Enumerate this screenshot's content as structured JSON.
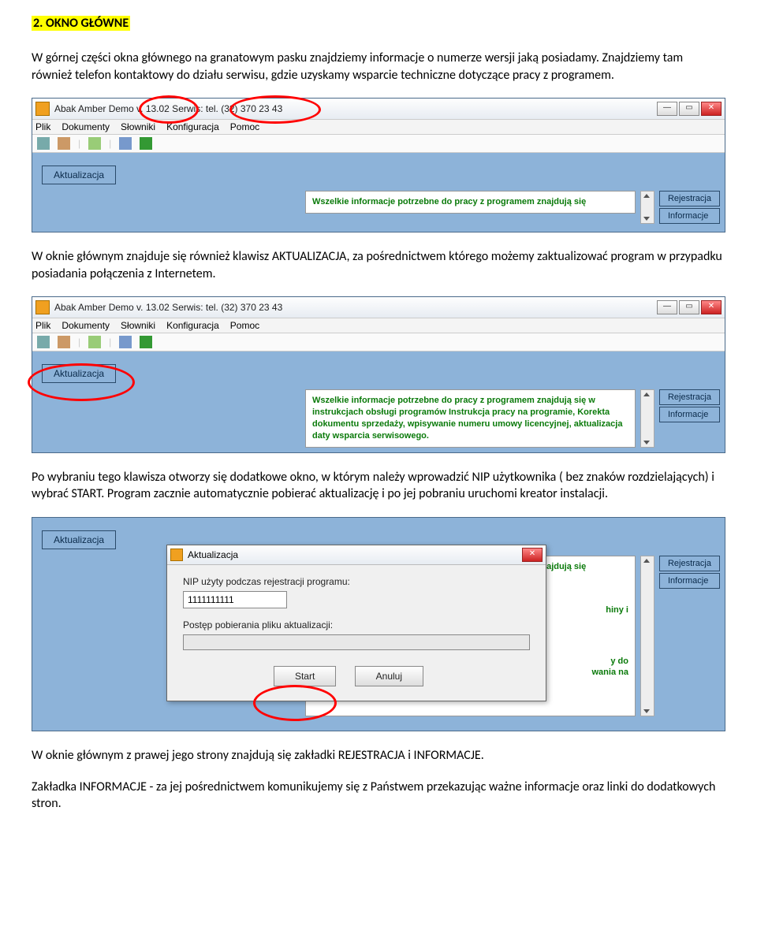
{
  "section": {
    "title": "2. OKNO GŁÓWNE",
    "p1": "W górnej części okna głównego na granatowym pasku znajdziemy informacje o numerze wersji jaką posiadamy. Znajdziemy tam również telefon kontaktowy do działu serwisu, gdzie uzyskamy wsparcie techniczne dotyczące pracy z programem.",
    "p2": "W oknie głównym znajduje się również klawisz AKTUALIZACJA, za pośrednictwem którego możemy zaktualizować program w przypadku posiadania połączenia z Internetem.",
    "p3": "Po wybraniu tego klawisza otworzy się dodatkowe okno, w którym należy wprowadzić NIP użytkownika ( bez znaków rozdzielających) i wybrać START. Program zacznie automatycznie pobierać aktualizację i po jej pobraniu uruchomi kreator instalacji.",
    "p4": "W oknie głównym z prawej jego strony znajdują się zakładki REJESTRACJA i INFORMACJE.",
    "p5": "Zakładka INFORMACJE - za jej pośrednictwem komunikujemy się z Państwem przekazując ważne informacje oraz linki do dodatkowych stron."
  },
  "app": {
    "title": "Abak Amber Demo v. 13.02   Serwis: tel. (32) 370 23 43",
    "menus": [
      "Plik",
      "Dokumenty",
      "Słowniki",
      "Konfiguracja",
      "Pomoc"
    ],
    "akt_label": "Aktualizacja",
    "side": {
      "rejestracja": "Rejestracja",
      "informacje": "Informacje"
    },
    "info_line1": "Wszelkie informacje potrzebne do pracy z programem znajdują się",
    "info_full": "Wszelkie informacje potrzebne do pracy z programem znajdują się w instrukcjach obsługi programów Instrukcja pracy na programie, Korekta dokumentu sprzedaży, wpisywanie numeru umowy licencyjnej, aktualizacja daty wsparcia serwisowego.",
    "info_frag1": "hiny i",
    "info_frag2": "y do",
    "info_frag3": "wania na"
  },
  "dialog": {
    "title": "Aktualizacja",
    "nip_label": "NIP użyty podczas rejestracji programu:",
    "nip_value": "1111111111",
    "progress_label": "Postęp pobierania pliku aktualizacji:",
    "start": "Start",
    "cancel": "Anuluj"
  }
}
